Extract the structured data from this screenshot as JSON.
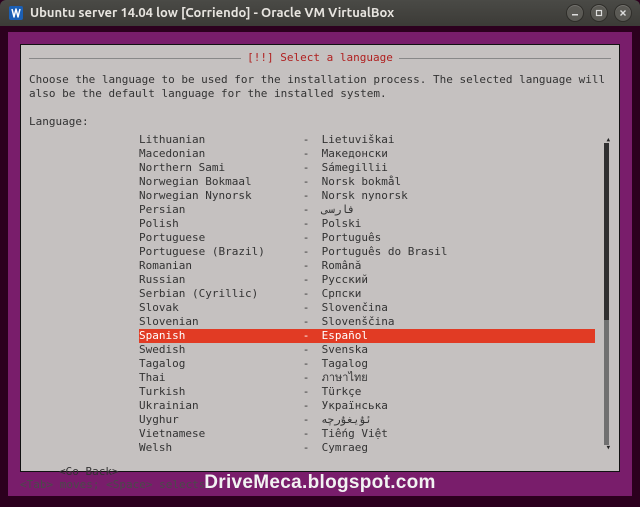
{
  "window": {
    "title": "Ubuntu server 14.04 low [Corriendo] - Oracle VM VirtualBox"
  },
  "installer": {
    "title": "[!!] Select a language",
    "intro": "Choose the language to be used for the installation process. The selected language will also be the default language for the installed system.",
    "label": "Language:",
    "go_back": "<Go Back>",
    "selected_index": 14,
    "languages": [
      {
        "english": "Lithuanian",
        "native": "Lietuviškai"
      },
      {
        "english": "Macedonian",
        "native": "Македонски"
      },
      {
        "english": "Northern Sami",
        "native": "Sámegillii"
      },
      {
        "english": "Norwegian Bokmaal",
        "native": "Norsk bokmål"
      },
      {
        "english": "Norwegian Nynorsk",
        "native": "Norsk nynorsk"
      },
      {
        "english": "Persian",
        "native": "فارسی"
      },
      {
        "english": "Polish",
        "native": "Polski"
      },
      {
        "english": "Portuguese",
        "native": "Português"
      },
      {
        "english": "Portuguese (Brazil)",
        "native": "Português do Brasil"
      },
      {
        "english": "Romanian",
        "native": "Română"
      },
      {
        "english": "Russian",
        "native": "Русский"
      },
      {
        "english": "Serbian (Cyrillic)",
        "native": "Српски"
      },
      {
        "english": "Slovak",
        "native": "Slovenčina"
      },
      {
        "english": "Slovenian",
        "native": "Slovenščina"
      },
      {
        "english": "Spanish",
        "native": "Español"
      },
      {
        "english": "Swedish",
        "native": "Svenska"
      },
      {
        "english": "Tagalog",
        "native": "Tagalog"
      },
      {
        "english": "Thai",
        "native": "ภาษาไทย"
      },
      {
        "english": "Turkish",
        "native": "Türkçe"
      },
      {
        "english": "Ukrainian",
        "native": "Українська"
      },
      {
        "english": "Uyghur",
        "native": "ئۇيغۇرچە"
      },
      {
        "english": "Vietnamese",
        "native": "Tiếng Việt"
      },
      {
        "english": "Welsh",
        "native": "Cymraeg"
      }
    ]
  },
  "hint": "<Tab> moves; <Space> selects;",
  "watermark": "DriveMeca.blogspot.com",
  "colors": {
    "desktop_purple": "#791d6b",
    "panel_gray": "#c5c1c0",
    "highlight_red": "#e13b24",
    "title_red": "#b02020"
  }
}
